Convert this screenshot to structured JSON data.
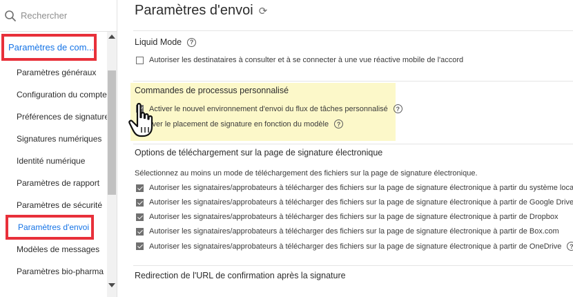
{
  "search": {
    "placeholder": "Rechercher",
    "icon": "search-icon"
  },
  "sidebar": {
    "group_label": "Paramètres de com...",
    "items": [
      {
        "label": "Paramètres généraux"
      },
      {
        "label": "Configuration du compte"
      },
      {
        "label": "Préférences de signature"
      },
      {
        "label": "Signatures numériques"
      },
      {
        "label": "Identité numérique"
      },
      {
        "label": "Paramètres de rapport"
      },
      {
        "label": "Paramètres de sécurité"
      },
      {
        "label": "Paramètres d'envoi"
      },
      {
        "label": "Modèles de messages"
      },
      {
        "label": "Paramètres bio-pharma"
      }
    ],
    "active_item": "Paramètres d'envoi"
  },
  "main": {
    "title": "Paramètres d'envoi",
    "liquid_mode": {
      "title": "Liquid Mode",
      "option": "Autoriser les destinataires à consulter et à se connecter à une vue réactive mobile de l'accord",
      "checked": false
    },
    "workflow": {
      "title": "Commandes de processus personnalisé",
      "option1": "Activer le nouvel environnement d'envoi du flux de tâches personnalisé",
      "option1_checked": true,
      "option2": "tiver le placement de signature en fonction du modèle"
    },
    "upload": {
      "title": "Options de téléchargement sur la page de signature électronique",
      "description": "Sélectionnez au moins un mode de téléchargement des fichiers sur la page de signature électronique.",
      "options": [
        {
          "label": "Autoriser les signataires/approbateurs à télécharger des fichiers sur la page de signature électronique à partir du système local",
          "checked": true
        },
        {
          "label": "Autoriser les signataires/approbateurs à télécharger des fichiers sur la page de signature électronique à partir de Google Drive",
          "checked": true
        },
        {
          "label": "Autoriser les signataires/approbateurs à télécharger des fichiers sur la page de signature électronique à partir de Dropbox",
          "checked": true
        },
        {
          "label": "Autoriser les signataires/approbateurs à télécharger des fichiers sur la page de signature électronique à partir de Box.com",
          "checked": true
        },
        {
          "label": "Autoriser les signataires/approbateurs à télécharger des fichiers sur la page de signature électronique à partir de OneDrive",
          "checked": true
        }
      ]
    },
    "redirect": {
      "title": "Redirection de l'URL de confirmation après la signature"
    }
  },
  "colors": {
    "accent": "#1473e6",
    "highlight_border": "#e8303a",
    "highlight_bg": "#fcf8c9"
  }
}
